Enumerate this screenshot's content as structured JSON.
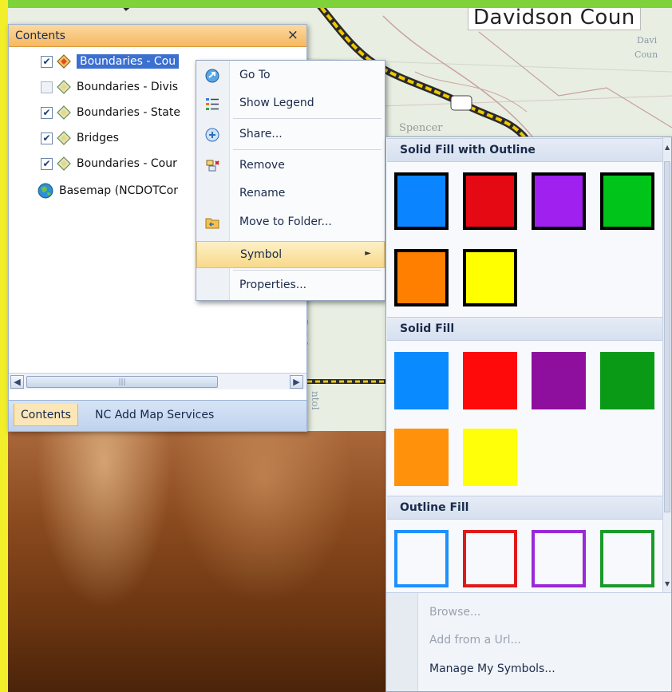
{
  "map": {
    "county_label": "Davidson Coun",
    "small_label_1": "Davi",
    "small_label_2": "Coun",
    "town_label": "Spencer",
    "vertical_label_1": "Dutch",
    "vertical_label_2": "ntol"
  },
  "contents_panel": {
    "title": "Contents",
    "close_glyph": "×",
    "layers": [
      {
        "label": "Boundaries - Cou",
        "checked": true,
        "selected": true,
        "icon": "layer-icon"
      },
      {
        "label": "Boundaries - Divis",
        "checked": false,
        "selected": false,
        "icon": "layer-icon"
      },
      {
        "label": "Boundaries - State",
        "checked": true,
        "selected": false,
        "icon": "layer-icon"
      },
      {
        "label": "Bridges",
        "checked": true,
        "selected": false,
        "icon": "layer-icon"
      },
      {
        "label": "Boundaries - Cour",
        "checked": true,
        "selected": false,
        "icon": "layer-icon"
      },
      {
        "label": "Basemap (NCDOTCor",
        "checked": null,
        "selected": false,
        "icon": "globe-icon"
      }
    ],
    "tabs": [
      {
        "label": "Contents",
        "active": true
      },
      {
        "label": "NC Add Map Services",
        "active": false
      }
    ]
  },
  "context_menu": {
    "items": [
      {
        "label": "Go To",
        "icon": "go-to-icon"
      },
      {
        "label": "Show Legend",
        "icon": "legend-icon"
      },
      {
        "label": "Share...",
        "icon": "share-icon"
      },
      {
        "label": "Remove",
        "icon": "remove-icon"
      },
      {
        "label": "Rename",
        "icon": "none"
      },
      {
        "label": "Move to Folder...",
        "icon": "folder-icon"
      },
      {
        "label": "Symbol",
        "icon": "none",
        "submenu_glyph": "►"
      },
      {
        "label": "Properties...",
        "icon": "none"
      }
    ]
  },
  "symbol_gallery": {
    "sections": [
      {
        "title": "Solid Fill with Outline"
      },
      {
        "title": "Solid Fill"
      },
      {
        "title": "Outline Fill"
      }
    ],
    "solid_fill_with_outline_colors": [
      "#0a84ff",
      "#e50914",
      "#a020f0",
      "#00c41a",
      "#ff7f00",
      "#ffff00"
    ],
    "solid_fill_colors": [
      "#0a8aff",
      "#ff0a0a",
      "#8e0f9e",
      "#0a9a16",
      "#ff920a",
      "#ffff0a"
    ],
    "outline_fill_colors": [
      "#1e90ff",
      "#e01a1a",
      "#9a28d8",
      "#1a9a2a"
    ],
    "footer": [
      {
        "label": "Browse...",
        "enabled": false
      },
      {
        "label": "Add from a Url...",
        "enabled": false
      },
      {
        "label": "Manage My Symbols...",
        "enabled": true
      }
    ]
  }
}
